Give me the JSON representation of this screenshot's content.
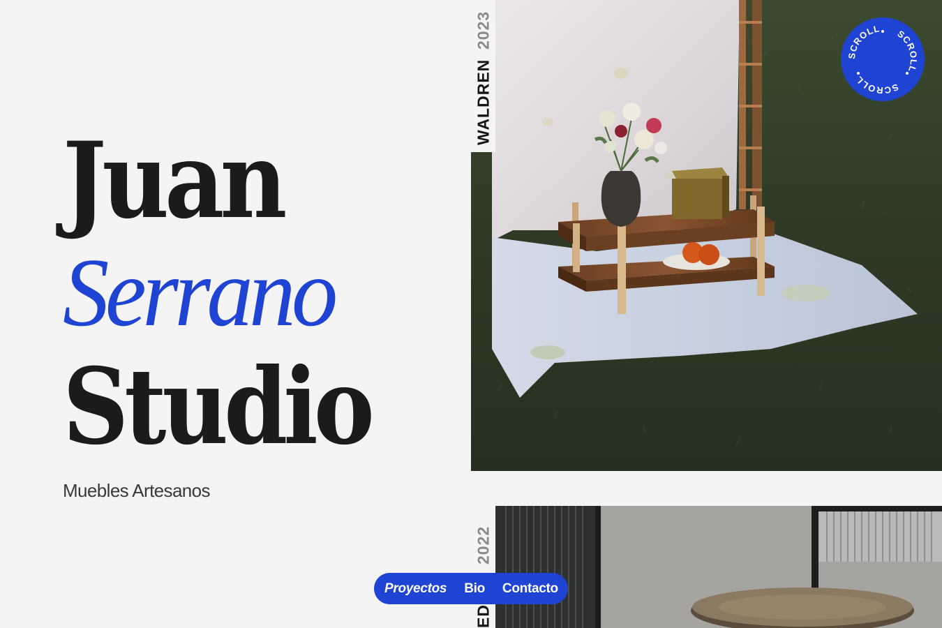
{
  "hero": {
    "line1": "Juan",
    "line2": "Serrano",
    "line3": "Studio",
    "subtitle": "Muebles Artesanos"
  },
  "projects": [
    {
      "name": "WALDREN",
      "year": "2023"
    },
    {
      "name": "EDO A",
      "year": "2022"
    }
  ],
  "scroll_badge": {
    "label": "SCROLL"
  },
  "nav": {
    "items": [
      {
        "label": "Proyectos",
        "active": true
      },
      {
        "label": "Bio",
        "active": false
      },
      {
        "label": "Contacto",
        "active": false
      }
    ]
  },
  "colors": {
    "accent": "#1f44d3",
    "background": "#f4f4f4",
    "text": "#1c1b19",
    "muted": "#8b8a86"
  }
}
